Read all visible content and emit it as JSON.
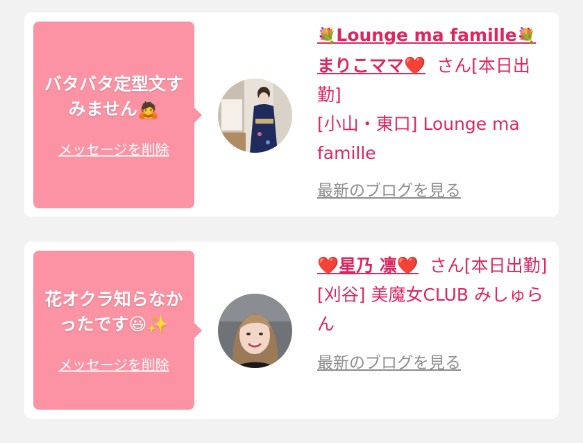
{
  "messages": [
    {
      "text": "バタバタ定型文すみません🙇",
      "delete_label": "メッセージを削除",
      "name_prefix": "💐",
      "name_line1": "Lounge ma famille",
      "name_suffix": "💐",
      "name_line2": "まりこママ",
      "name_heart": "❤️",
      "san": "さん",
      "status": "[本日出勤]",
      "shop": "[小山・東口] Lounge ma famille",
      "blog_label": "最新のブログを見る"
    },
    {
      "text": "花オクラ知らなかったです😃✨",
      "delete_label": "メッセージを削除",
      "name_prefix": "❤️",
      "name_line2": "星乃 凛",
      "name_heart": "❤️",
      "san": "さん",
      "status": "[本日出勤]",
      "shop": "[刈谷] 美魔女CLUB みしゅらん",
      "blog_label": "最新のブログを見る"
    }
  ],
  "colors": {
    "background": "#f2f2f2",
    "bubble": "#fb93a4",
    "accent": "#e0245e",
    "link_gray": "#8d8d8d"
  }
}
